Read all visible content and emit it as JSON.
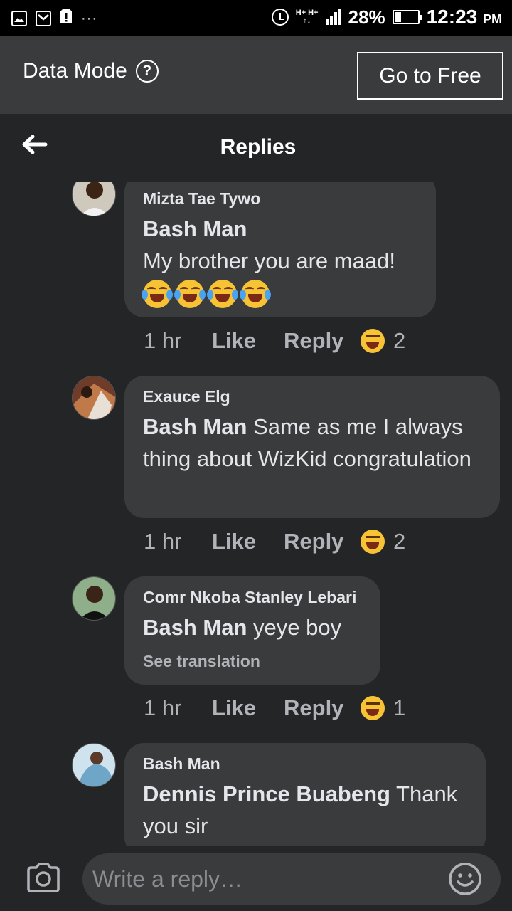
{
  "status_bar": {
    "network": "H+ H+",
    "battery_percent": "28%",
    "battery_level": 0.28,
    "time": "12:23",
    "ampm": "PM",
    "dots": "···"
  },
  "data_mode": {
    "label": "Data Mode",
    "help": "?",
    "go_free": "Go to Free"
  },
  "header": {
    "title": "Replies"
  },
  "comments": [
    {
      "author": "Mizta Tae Tywo",
      "mention": "Bash Man",
      "text": "My brother you are maad!",
      "emoji_count": 4,
      "time": "1 hr",
      "like": "Like",
      "reply": "Reply",
      "reactions": "2"
    },
    {
      "author": "Exauce Elg",
      "mention": "Bash Man",
      "text": " Same as me I always thing about WizKid congratulation",
      "time": "1 hr",
      "like": "Like",
      "reply": "Reply",
      "reactions": "2"
    },
    {
      "author": "Comr Nkoba Stanley Lebari",
      "mention": "Bash Man",
      "text": " yeye boy",
      "see_translation": "See translation",
      "time": "1 hr",
      "like": "Like",
      "reply": "Reply",
      "reactions": "1"
    },
    {
      "author": "Bash Man",
      "mention": "Dennis Prince Buabeng",
      "text": " Thank you sir"
    }
  ],
  "composer": {
    "placeholder": "Write a reply…"
  },
  "colors": {
    "background": "#242526",
    "bubble": "#3a3b3c",
    "secondary_text": "#b0b3b8",
    "primary_text": "#e4e6eb"
  }
}
